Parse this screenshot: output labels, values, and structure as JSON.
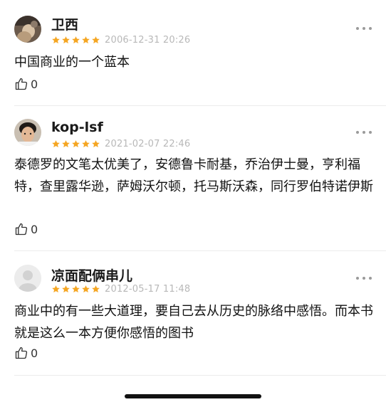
{
  "colors": {
    "star": "#f5a623",
    "divider": "#ececec"
  },
  "comments": [
    {
      "username": "卫西",
      "rating": 5,
      "date": "2006-12-31 20:26",
      "text": "中国商业的一个蓝本",
      "likes": "0"
    },
    {
      "username": "kop-lsf",
      "rating": 5,
      "date": "2021-02-07 22:46",
      "text": "泰德罗的文笔太优美了，安德鲁卡耐基，乔治伊士曼，亨利福特，查里露华逊，萨姆沃尔顿，托马斯沃森，同行罗伯特诺伊斯",
      "likes": "0"
    },
    {
      "username": "凉面配俩串儿",
      "rating": 5,
      "date": "2012-05-17 11:48",
      "text": "商业中的有一些大道理，要自己去从历史的脉络中感悟。而本书就是这么一本方便你感悟的图书",
      "likes": "0"
    }
  ],
  "icons": {
    "more": "more-dots-icon",
    "like": "thumbs-up-icon",
    "star": "star-icon"
  }
}
